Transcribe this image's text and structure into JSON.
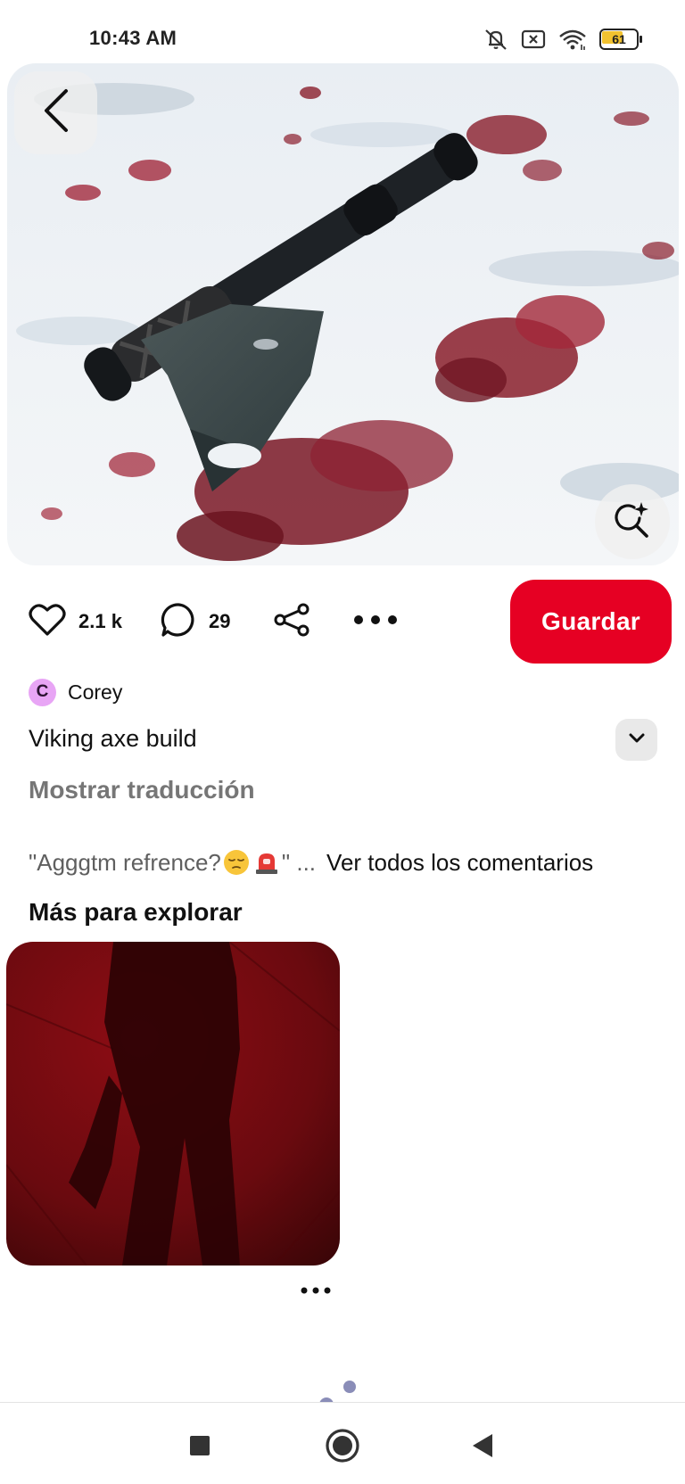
{
  "status_bar": {
    "time": "10:43 AM",
    "battery_level": "61",
    "icons": [
      "mute-icon",
      "notification-x-icon",
      "wifi-icon",
      "battery-icon"
    ]
  },
  "hero": {
    "icons": {
      "back": "chevron-left-icon",
      "visual_search": "visual-search-sparkle-icon"
    }
  },
  "actions": {
    "likes_count": "2.1 k",
    "comments_count": "29",
    "icons": [
      "heart-icon",
      "comment-bubble-icon",
      "share-icon",
      "more-dots-icon"
    ],
    "save_label": "Guardar"
  },
  "pin": {
    "author_initial": "C",
    "author_name": "Corey",
    "title": "Viking axe build",
    "show_translation": "Mostrar traducción"
  },
  "comments": {
    "preview_text_before_emoji": "\"Agggtm refrence?",
    "preview_text_after_emoji": "\" ...",
    "see_all_label": "Ver todos los comentarios"
  },
  "explore": {
    "section_title": "Más para explorar"
  },
  "colors": {
    "save_button": "#e60023",
    "avatar_background": "#e8a5f5",
    "secondary_text": "#767676"
  },
  "nav_bar": {
    "buttons": [
      "recents-square-icon",
      "home-circle-icon",
      "back-triangle-icon"
    ]
  }
}
